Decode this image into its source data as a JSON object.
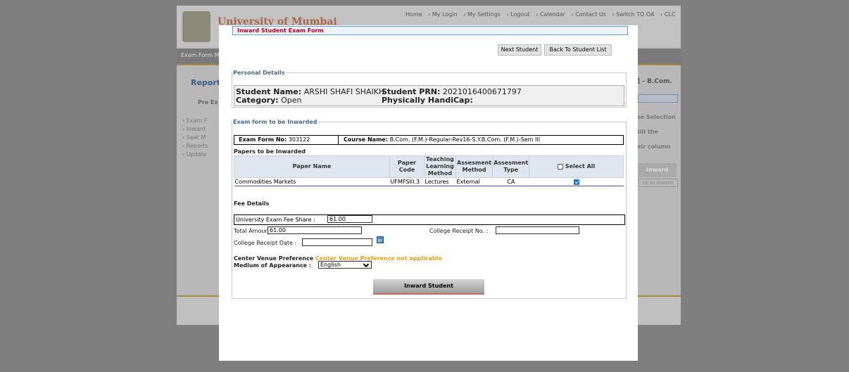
{
  "background": {
    "university_title": "University of Mumbai",
    "top_links": [
      "Home",
      "› My Login",
      "› My Settings",
      "› Logout",
      "› Calendar",
      "› Contact Us",
      "› Switch TO OA",
      "› CLC"
    ],
    "nav_text": "Exam Form M",
    "report_title": "Report",
    "pre_exam": "Pre Ex",
    "side_items": [
      "› Exam F",
      "› Inward",
      "› Seat M",
      "› Reports",
      "› Update"
    ],
    "right_header": "] - B.Com.",
    "right_lines": [
      "se Selection",
      "till the",
      "eir column"
    ],
    "inward_button": "Inward",
    "back_to_inward": "ck to inward"
  },
  "modal": {
    "title": "Inward Student Exam Form",
    "next_student": "Next Student",
    "back_to_list": "Back To Student List",
    "personal_details": {
      "legend": "Personal Details",
      "student_name_label": "Student Name:",
      "student_name": "ARSHI SHAFI SHAIKH",
      "prn_label": "Student PRN:",
      "prn": "2021016400671797",
      "category_label": "Category:",
      "category": "Open",
      "handicap_label": "Physically HandiCap:"
    },
    "exam_form": {
      "legend": "Exam form to be Inwarded",
      "form_no_label": "Exam Form No:",
      "form_no": "303122",
      "course_label": "Course Name:",
      "course": "B.Com. (F.M.)-Regular-Rev16-S.Y.B.Com. (F.M.)-Sem III",
      "papers_label": "Papers to be Inwarded",
      "headers": [
        "Paper Name",
        "Paper Code",
        "Teaching Learning Method",
        "Assesment Method",
        "Assesment Type",
        "Select All"
      ],
      "rows": [
        {
          "name": "Commodities Markets",
          "code": "UFMFSIII.3",
          "method": "Lectures",
          "assess_method": "External",
          "assess_type": "CA",
          "selected": true
        }
      ],
      "fee_label": "Fee Details",
      "univ_fee_label": "University Exam Fee Share :",
      "univ_fee": "61.00",
      "total_label": "Total Amount:",
      "total": "61.00",
      "receipt_no_label": "College Receipt No. :",
      "receipt_no": "",
      "receipt_date_label": "College Receipt Date :",
      "receipt_date": "",
      "cvp_label": "Center Venue Preference",
      "cvp_value": "Center Venue Preference not applicable",
      "medium_label": "Medium of Appearance  :",
      "medium_value": "English",
      "inward_button": "Inward Student"
    }
  }
}
